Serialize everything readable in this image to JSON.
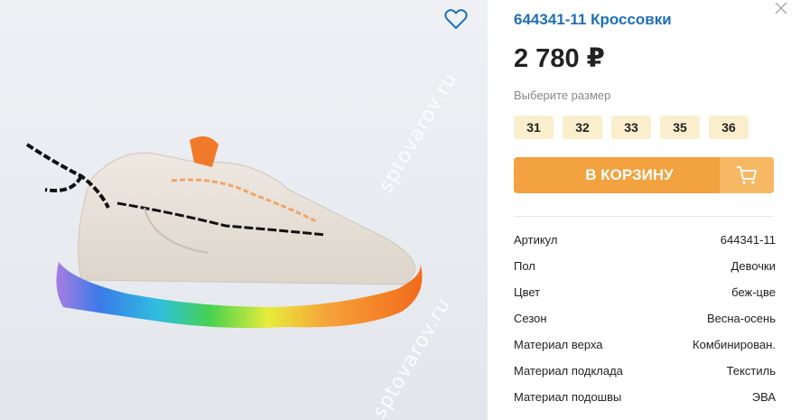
{
  "product": {
    "title": "644341-11 Кроссовки",
    "price": "2 780 ₽",
    "size_prompt": "Выберите размер",
    "sizes": [
      "31",
      "32",
      "33",
      "35",
      "36"
    ],
    "cart_button_label": "В КОРЗИНУ"
  },
  "specs": [
    {
      "key": "Артикул",
      "value": "644341-11"
    },
    {
      "key": "Пол",
      "value": "Девочки"
    },
    {
      "key": "Цвет",
      "value": "беж-цве"
    },
    {
      "key": "Сезон",
      "value": "Весна-осень"
    },
    {
      "key": "Материал верха",
      "value": "Комбинирован."
    },
    {
      "key": "Материал подклада",
      "value": "Текстиль"
    },
    {
      "key": "Материал подошвы",
      "value": "ЭВА"
    }
  ],
  "watermark": "sptovarov.ru",
  "icons": {
    "favorite": "heart-icon",
    "close": "close-icon",
    "cart": "cart-icon"
  },
  "colors": {
    "title": "#1f6fb8",
    "accent": "#f2a23f",
    "size_chip": "#fbeecd"
  }
}
